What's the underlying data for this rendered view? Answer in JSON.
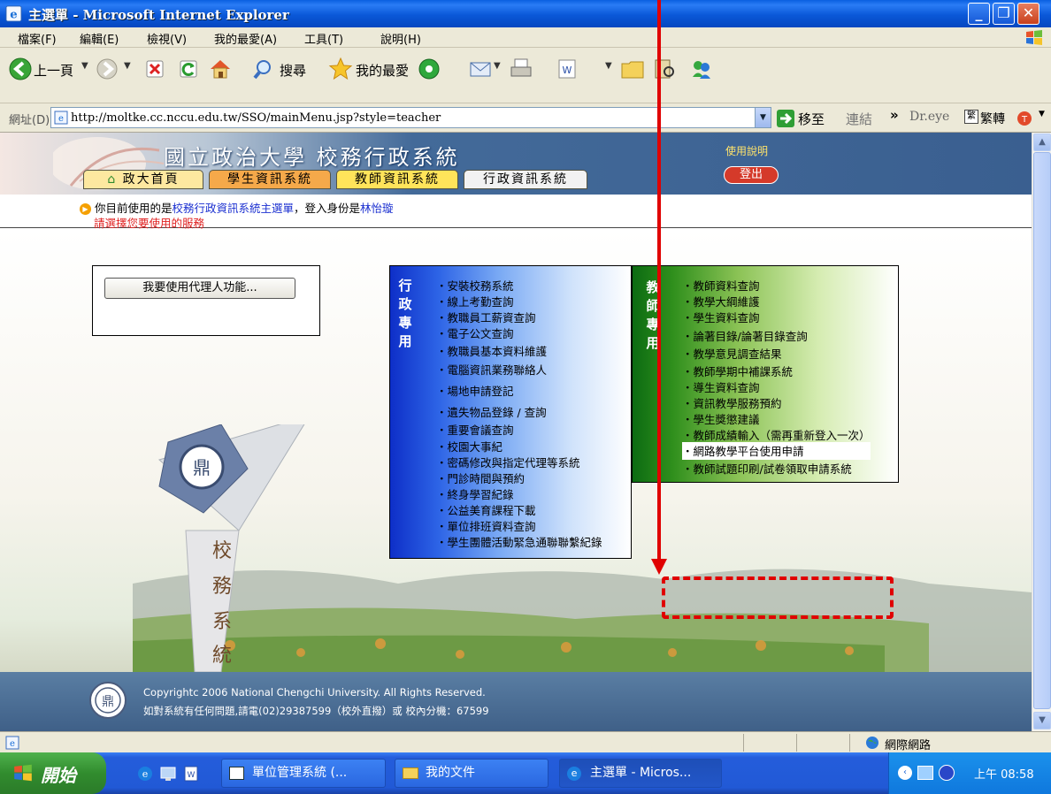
{
  "window": {
    "title": "主選單 - Microsoft Internet Explorer"
  },
  "menu": [
    "檔案(F)",
    "編輯(E)",
    "檢視(V)",
    "我的最愛(A)",
    "工具(T)",
    "說明(H)"
  ],
  "toolbar": {
    "back_label": "上一頁",
    "search_label": "搜尋",
    "favorites_label": "我的最愛"
  },
  "address": {
    "label": "網址(D)",
    "url": "http://moltke.cc.nccu.edu.tw/SSO/mainMenu.jsp?style=teacher",
    "go_label": "移至",
    "links_label": "連結",
    "chevron": "»",
    "dreye_label": "Dr.eye",
    "convert_label": "繁轉"
  },
  "page": {
    "site_title": "國立政治大學 校務行政系統",
    "nav_tabs": [
      "政大首頁",
      "學生資訊系統",
      "教師資訊系統",
      "行政資訊系統"
    ],
    "help_link": "使用說明",
    "logout_label": "登出",
    "info_prefix": "你目前使用的是",
    "info_system": "校務行政資訊系統主選單",
    "info_mid": "，登入身份是",
    "info_user": "林怡璇",
    "info_line2": "請選擇您要使用的服務",
    "proxy_button": "我要使用代理人功能...",
    "admin_panel_label": [
      "行",
      "政",
      "專",
      "用"
    ],
    "admin_items": [
      "安裝校務系統",
      "線上考勤查詢",
      "教職員工薪資查詢",
      "電子公文查詢",
      "教職員基本資料維護",
      "電腦資訊業務聯絡人",
      "場地申請登記",
      "遺失物品登錄 / 查詢",
      "重要會議查詢",
      "校園大事紀",
      "密碼修改與指定代理等系統",
      "門診時間與預約",
      "終身學習紀錄",
      "公益美育課程下載",
      "單位排班資料查詢",
      "學生團體活動緊急通聯聯繫紀錄"
    ],
    "teacher_panel_label": [
      "教",
      "師",
      "專",
      "用"
    ],
    "teacher_items": [
      "教師資料查詢",
      "教學大綱維護",
      "學生資料查詢",
      "論著目錄/論著目錄查詢",
      "教學意見調查結果",
      "教師學期中補課系統",
      "導生資料查詢",
      "資訊教學服務預約",
      "學生獎懲建議",
      "教師成績輸入（需再重新登入一次）",
      "網路教學平台使用申請",
      "教師試題印刷/試卷領取申請系統"
    ],
    "bullet": "・",
    "footer_line1": "Copyrightc 2006 National Chengchi University. All Rights Reserved.",
    "footer_line2": "如對系統有任何問題,請電(02)29387599（校外直撥）或 校內分機：67599",
    "school_seal_text": "校務系統"
  },
  "statusbar": {
    "zone": "網際網路"
  },
  "taskbar": {
    "start_label": "開始",
    "tasks": [
      "單位管理系統 (...",
      "我的文件",
      "主選單 - Micros..."
    ],
    "clock": "上午 08:58"
  },
  "colors": {
    "title_blue": "#0a58d8",
    "annotation_red": "#e00000",
    "teacher_green": "#2f8f1c",
    "admin_blue": "#1a3fd0"
  }
}
